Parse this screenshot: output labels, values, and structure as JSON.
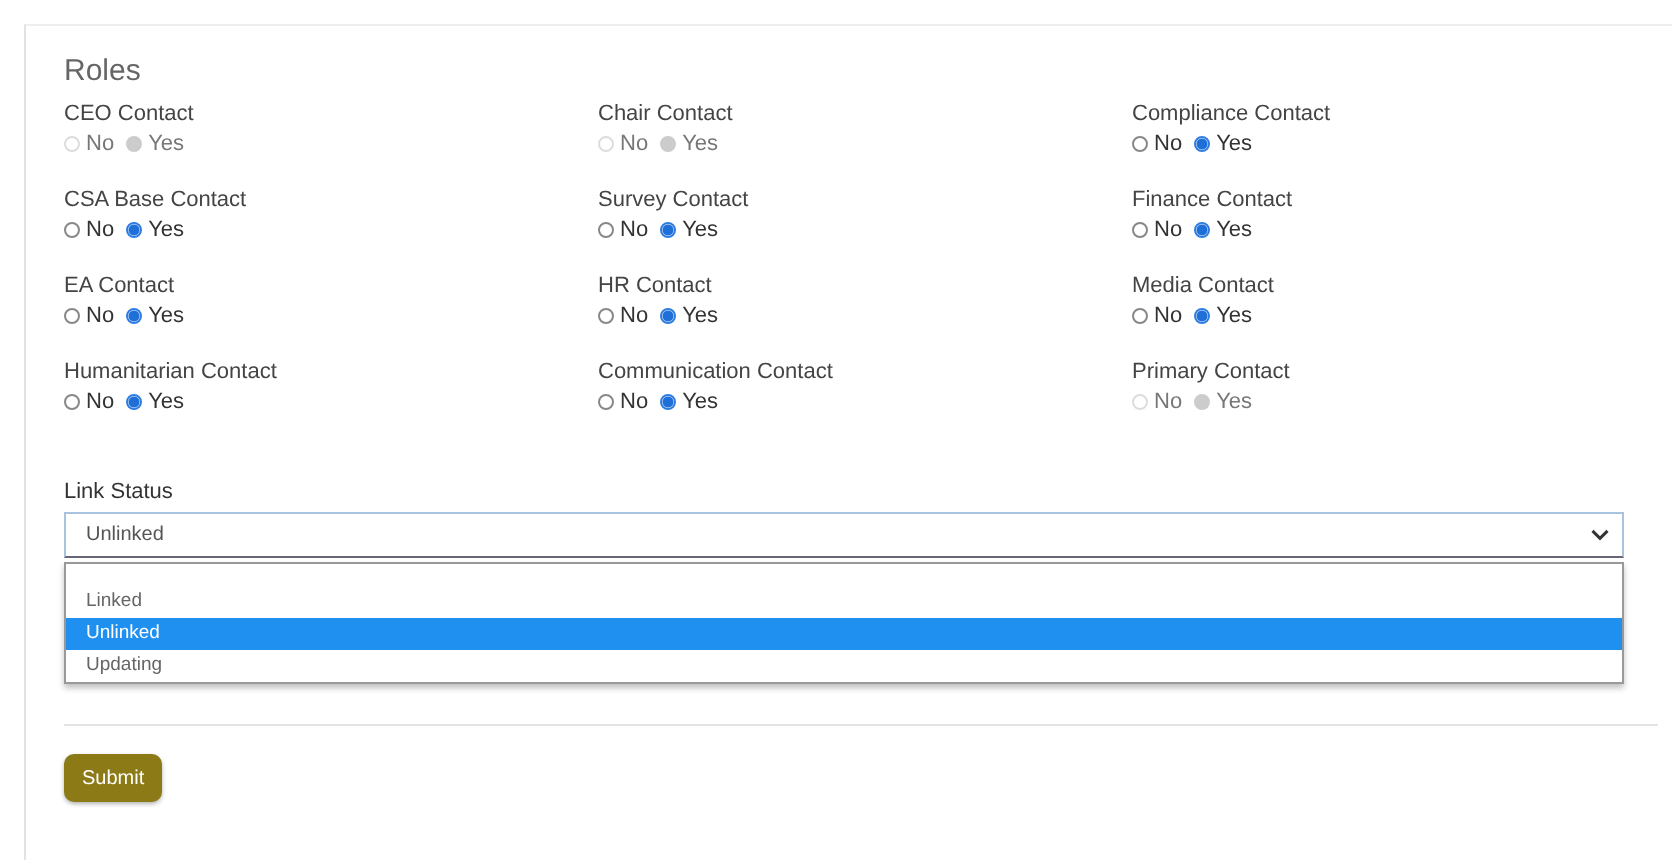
{
  "section_title": "Roles",
  "roles": [
    {
      "label": "CEO Contact",
      "disabled": true,
      "options": [
        {
          "label": "No",
          "selected": false
        },
        {
          "label": "Yes",
          "selected": true
        }
      ]
    },
    {
      "label": "Chair Contact",
      "disabled": true,
      "options": [
        {
          "label": "No",
          "selected": false
        },
        {
          "label": "Yes",
          "selected": true
        }
      ]
    },
    {
      "label": "Compliance Contact",
      "disabled": false,
      "options": [
        {
          "label": "No",
          "selected": false
        },
        {
          "label": "Yes",
          "selected": true
        }
      ]
    },
    {
      "label": "CSA Base Contact",
      "disabled": false,
      "options": [
        {
          "label": "No",
          "selected": false
        },
        {
          "label": "Yes",
          "selected": true
        }
      ]
    },
    {
      "label": "Survey Contact",
      "disabled": false,
      "options": [
        {
          "label": "No",
          "selected": false
        },
        {
          "label": "Yes",
          "selected": true
        }
      ]
    },
    {
      "label": "Finance Contact",
      "disabled": false,
      "options": [
        {
          "label": "No",
          "selected": false
        },
        {
          "label": "Yes",
          "selected": true
        }
      ]
    },
    {
      "label": "EA Contact",
      "disabled": false,
      "options": [
        {
          "label": "No",
          "selected": false
        },
        {
          "label": "Yes",
          "selected": true
        }
      ]
    },
    {
      "label": "HR Contact",
      "disabled": false,
      "options": [
        {
          "label": "No",
          "selected": false
        },
        {
          "label": "Yes",
          "selected": true
        }
      ]
    },
    {
      "label": "Media Contact",
      "disabled": false,
      "options": [
        {
          "label": "No",
          "selected": false
        },
        {
          "label": "Yes",
          "selected": true
        }
      ]
    },
    {
      "label": "Humanitarian Contact",
      "disabled": false,
      "options": [
        {
          "label": "No",
          "selected": false
        },
        {
          "label": "Yes",
          "selected": true
        }
      ]
    },
    {
      "label": "Communication Contact",
      "disabled": false,
      "options": [
        {
          "label": "No",
          "selected": false
        },
        {
          "label": "Yes",
          "selected": true
        }
      ]
    },
    {
      "label": "Primary Contact",
      "disabled": true,
      "options": [
        {
          "label": "No",
          "selected": false
        },
        {
          "label": "Yes",
          "selected": true
        }
      ]
    }
  ],
  "link_status": {
    "label": "Link Status",
    "value": "Unlinked",
    "expanded": true,
    "options": [
      {
        "label": "Linked",
        "selected": false
      },
      {
        "label": "Unlinked",
        "selected": true
      },
      {
        "label": "Updating",
        "selected": false
      }
    ]
  },
  "submit_button": "Submit"
}
